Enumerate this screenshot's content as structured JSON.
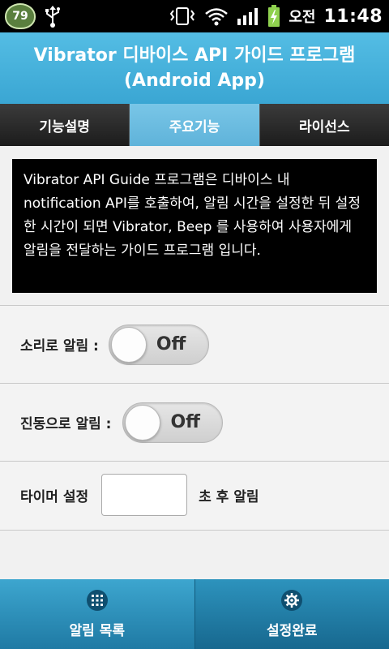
{
  "status_bar": {
    "badge_count": "79",
    "ampm": "오전",
    "time": "11:48"
  },
  "header": {
    "title_line1": "Vibrator 디바이스 API 가이드 프로그램",
    "title_line2": "(Android App)"
  },
  "tabs": [
    {
      "label": "기능설명",
      "active": false
    },
    {
      "label": "주요기능",
      "active": true
    },
    {
      "label": "라이선스",
      "active": false
    }
  ],
  "description": "Vibrator API Guide 프로그램은 디바이스 내 notification API를 호출하여, 알림 시간을 설정한 뒤 설정한 시간이 되면 Vibrator, Beep 를 사용하여 사용자에게 알림을 전달하는 가이드 프로그램 입니다.",
  "settings": {
    "sound": {
      "label": "소리로 알림 :",
      "state": "Off"
    },
    "vibrate": {
      "label": "진동으로 알림 :",
      "state": "Off"
    },
    "timer": {
      "label": "타이머 설정",
      "value": "",
      "suffix": "초 후 알림"
    }
  },
  "bottom_bar": {
    "left": {
      "label": "알림 목록",
      "icon": "grid-icon"
    },
    "right": {
      "label": "설정완료",
      "icon": "gear-icon"
    }
  },
  "colors": {
    "title_bar": "#3aa6d3",
    "active_tab": "#6cbde1",
    "bottom_bar": "#2a8cb8"
  }
}
